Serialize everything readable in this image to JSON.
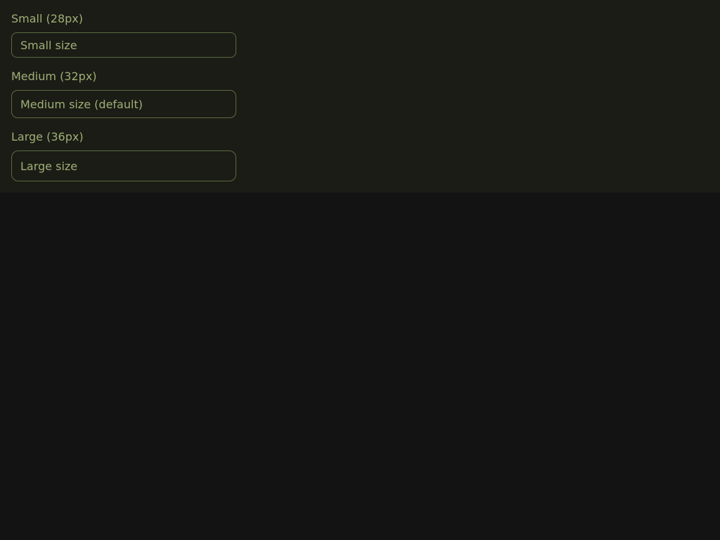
{
  "fields": [
    {
      "label": "Small (28px)",
      "placeholder": "Small size",
      "value": ""
    },
    {
      "label": "Medium (32px)",
      "placeholder": "Medium size (default)",
      "value": ""
    },
    {
      "label": "Large (36px)",
      "placeholder": "Large size",
      "value": ""
    }
  ],
  "colors": {
    "page_background": "#131313",
    "panel_background": "#1b1c15",
    "text": "#9fae78",
    "border": "#5c6a40"
  }
}
